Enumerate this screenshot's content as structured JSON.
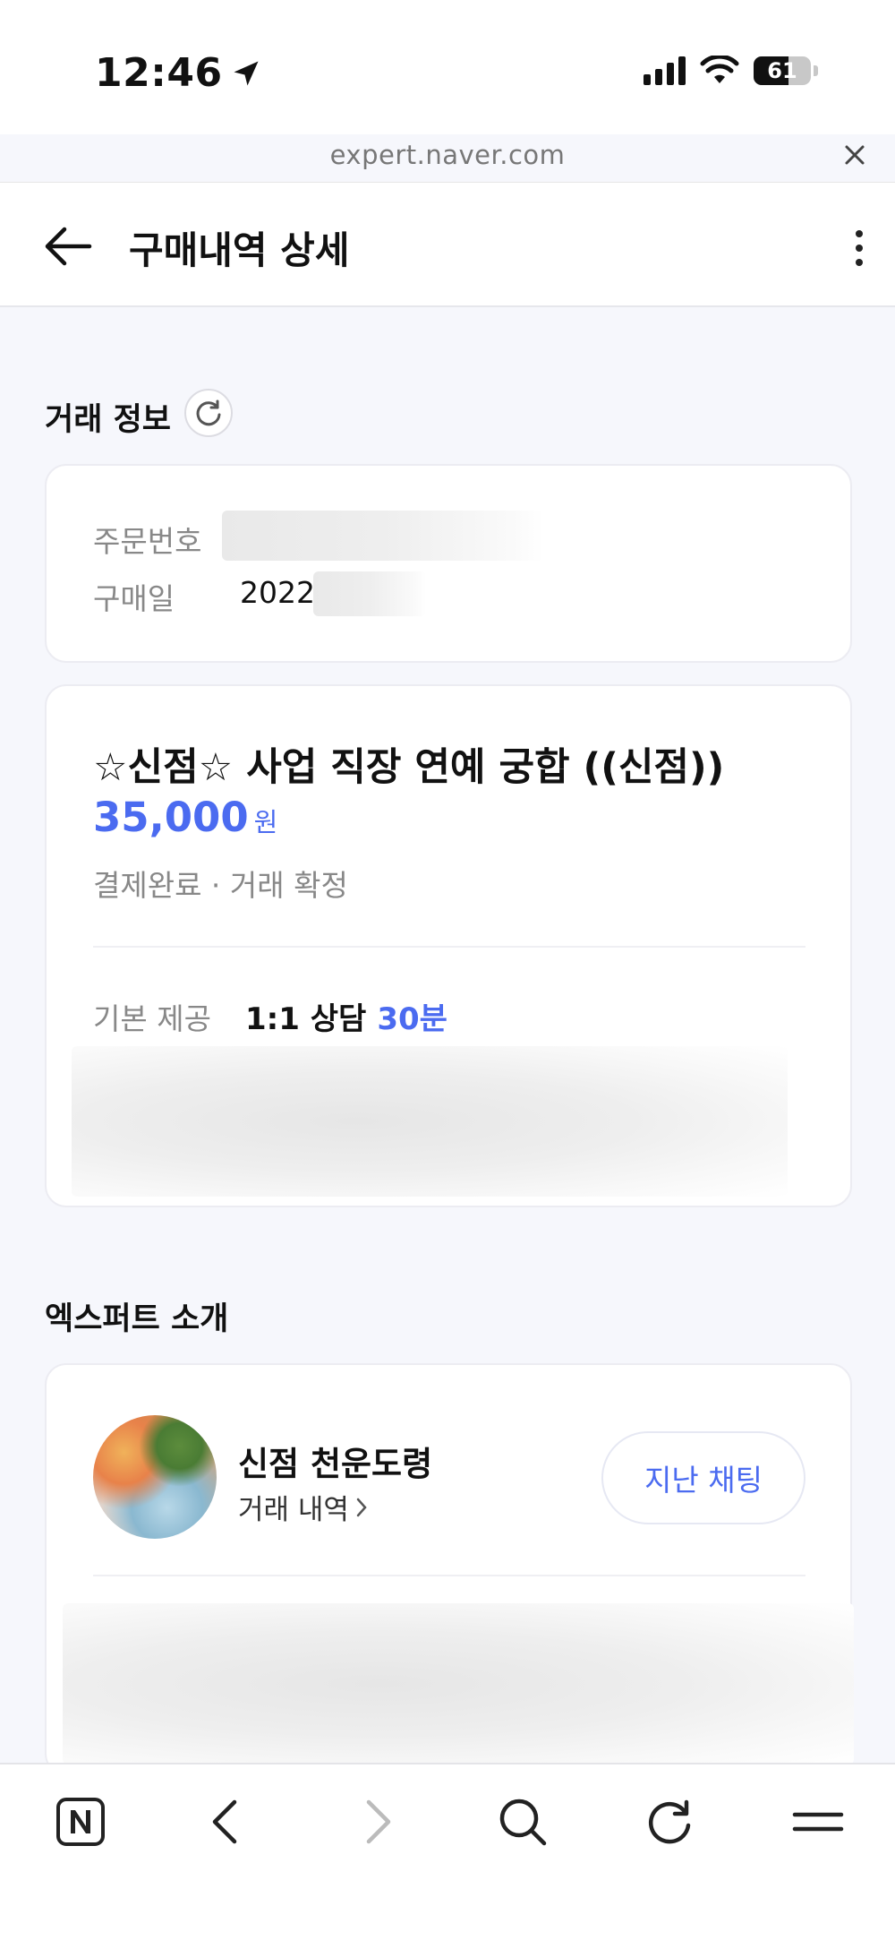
{
  "status_bar": {
    "time": "12:46",
    "battery": "61",
    "battery_level_percent": 61
  },
  "browser": {
    "url": "expert.naver.com"
  },
  "header": {
    "title": "구매내역 상세"
  },
  "transaction_section": {
    "title": "거래 정보",
    "order_number_label": "주문번호",
    "purchase_date_label": "구매일",
    "purchase_date_value": "2022"
  },
  "product": {
    "title": "☆신점☆ 사업 직장 연예 궁합 ((신점))",
    "price": "35,000",
    "price_unit": "원",
    "status": "결제완료 · 거래 확정",
    "basic_offer_label": "기본 제공",
    "basic_offer_value": "1:1 상담",
    "basic_offer_duration": "30분"
  },
  "expert_section": {
    "title": "엑스퍼트 소개",
    "name": "신점 천운도령",
    "history_link": "거래 내역",
    "chat_button": "지난 채팅"
  },
  "toolbar": {
    "icons": [
      "naver-icon",
      "back-icon",
      "forward-icon",
      "search-icon",
      "reload-icon",
      "menu-icon"
    ]
  },
  "colors": {
    "accent": "#4b6bf0",
    "background": "#f6f7fc"
  }
}
